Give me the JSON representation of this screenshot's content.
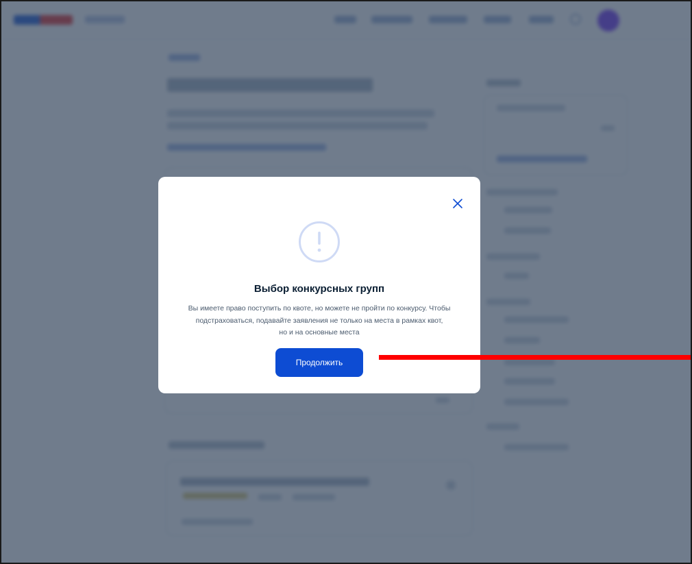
{
  "modal": {
    "close_icon": "close-icon",
    "warning_icon": "exclamation-circle-icon",
    "title": "Выбор конкурсных групп",
    "description_lines": [
      "Вы имеете право поступить по квоте, но можете не пройти по конкурсу. Чтобы",
      "подстраховаться, подавайте заявления не только на места в рамках квот,",
      "но и на основные места"
    ],
    "continue_label": "Продолжить"
  },
  "colors": {
    "primary": "#0d4cd3",
    "overlay": "#2c3e55",
    "warning_icon": "#cfdaf5",
    "annotation": "#ff0000",
    "title_text": "#0b1f33"
  }
}
